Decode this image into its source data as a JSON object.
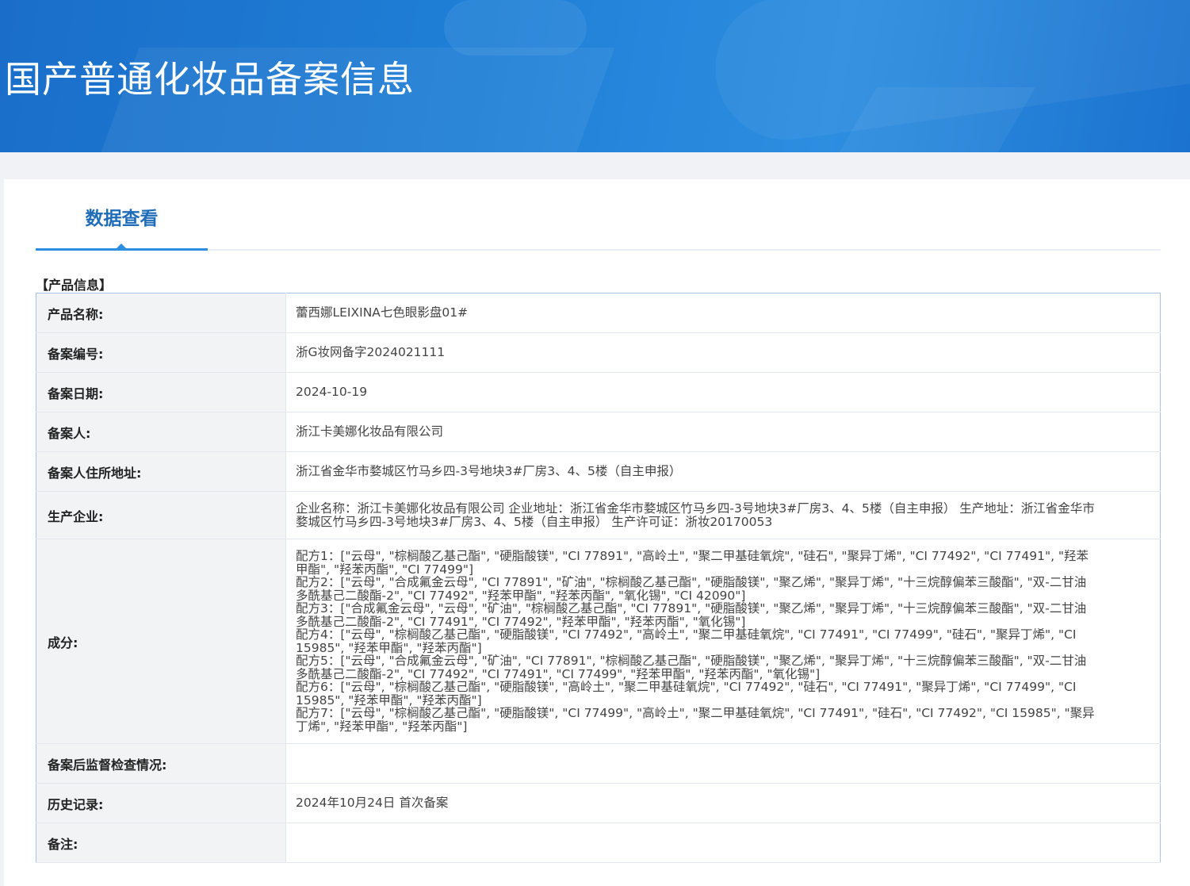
{
  "header": {
    "title": "国产普通化妆品备案信息"
  },
  "tabs": [
    {
      "label": "数据查看",
      "active": true
    }
  ],
  "section": {
    "title": "【产品信息】"
  },
  "fields": {
    "product_name": {
      "label": "产品名称:",
      "value": "蕾西娜LEIXINA七色眼影盘01#"
    },
    "record_no": {
      "label": "备案编号:",
      "value": "浙G妆网备字2024021111"
    },
    "record_date": {
      "label": "备案日期:",
      "value": "2024-10-19"
    },
    "registrant": {
      "label": "备案人:",
      "value": "浙江卡美娜化妆品有限公司"
    },
    "address": {
      "label": "备案人住所地址:",
      "value": "浙江省金华市婺城区竹马乡四-3号地块3#厂房3、4、5楼（自主申报）"
    },
    "manufacturer": {
      "label": "生产企业:",
      "value": "企业名称：浙江卡美娜化妆品有限公司 企业地址：浙江省金华市婺城区竹马乡四-3号地块3#厂房3、4、5楼（自主申报） 生产地址：浙江省金华市婺城区竹马乡四-3号地块3#厂房3、4、5楼（自主申报） 生产许可证：浙妆20170053"
    },
    "ingredients": {
      "label": "成分:",
      "lines": [
        "配方1：[\"云母\", \"棕榈酸乙基己酯\", \"硬脂酸镁\", \"CI 77891\", \"高岭土\", \"聚二甲基硅氧烷\", \"硅石\", \"聚异丁烯\", \"CI 77492\", \"CI 77491\", \"羟苯甲酯\", \"羟苯丙酯\", \"CI 77499\"]",
        "配方2：[\"云母\", \"合成氟金云母\", \"CI 77891\", \"矿油\", \"棕榈酸乙基己酯\", \"硬脂酸镁\", \"聚乙烯\", \"聚异丁烯\", \"十三烷醇偏苯三酸酯\", \"双-二甘油多酰基己二酸酯-2\", \"CI 77492\", \"羟苯甲酯\", \"羟苯丙酯\", \"氧化锡\", \"CI 42090\"]",
        "配方3：[\"合成氟金云母\", \"云母\", \"矿油\", \"棕榈酸乙基己酯\", \"CI 77891\", \"硬脂酸镁\", \"聚乙烯\", \"聚异丁烯\", \"十三烷醇偏苯三酸酯\", \"双-二甘油多酰基己二酸酯-2\", \"CI 77491\", \"CI 77492\", \"羟苯甲酯\", \"羟苯丙酯\", \"氧化锡\"]",
        "配方4：[\"云母\", \"棕榈酸乙基己酯\", \"硬脂酸镁\", \"CI 77492\", \"高岭土\", \"聚二甲基硅氧烷\", \"CI 77491\", \"CI 77499\", \"硅石\", \"聚异丁烯\", \"CI 15985\", \"羟苯甲酯\", \"羟苯丙酯\"]",
        "配方5：[\"云母\", \"合成氟金云母\", \"矿油\", \"CI 77891\", \"棕榈酸乙基己酯\", \"硬脂酸镁\", \"聚乙烯\", \"聚异丁烯\", \"十三烷醇偏苯三酸酯\", \"双-二甘油多酰基己二酸酯-2\", \"CI 77492\", \"CI 77491\", \"CI 77499\", \"羟苯甲酯\", \"羟苯丙酯\", \"氧化锡\"]",
        "配方6：[\"云母\", \"棕榈酸乙基己酯\", \"硬脂酸镁\", \"高岭土\", \"聚二甲基硅氧烷\", \"CI 77492\", \"硅石\", \"CI 77491\", \"聚异丁烯\", \"CI 77499\", \"CI 15985\", \"羟苯甲酯\", \"羟苯丙酯\"]",
        "配方7：[\"云母\", \"棕榈酸乙基己酯\", \"硬脂酸镁\", \"CI 77499\", \"高岭土\", \"聚二甲基硅氧烷\", \"CI 77491\", \"硅石\", \"CI 77492\", \"CI 15985\", \"聚异丁烯\", \"羟苯甲酯\", \"羟苯丙酯\"]"
      ]
    },
    "inspection": {
      "label": "备案后监督检查情况:",
      "value": ""
    },
    "history": {
      "label": "历史记录:",
      "value": "2024年10月24日 首次备案"
    },
    "remarks": {
      "label": "备注:",
      "value": ""
    }
  },
  "colors": {
    "banner": "#1f7fd6",
    "accent": "#2d8ee0",
    "tab_text": "#1f6db8",
    "table_border": "#a9c4e2"
  }
}
